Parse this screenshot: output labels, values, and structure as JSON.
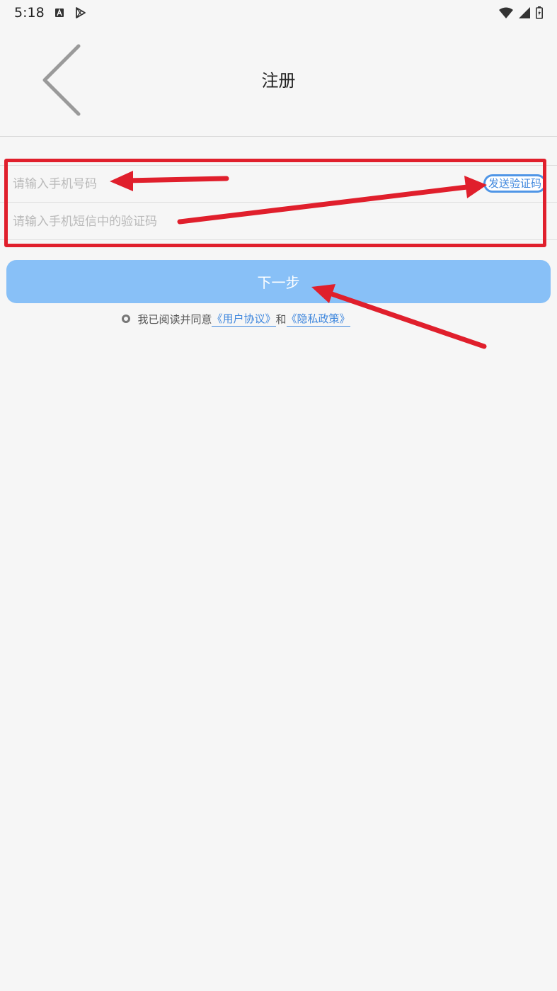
{
  "status_bar": {
    "time": "5:18",
    "icons": [
      "text-app-icon",
      "play-store-icon",
      "wifi-icon",
      "signal-icon",
      "battery-icon"
    ]
  },
  "header": {
    "back_icon": "chevron-left-icon",
    "title": "注册"
  },
  "form": {
    "phone_placeholder": "请输入手机号码",
    "phone_value": "",
    "code_placeholder": "请输入手机短信中的验证码",
    "code_value": "",
    "send_code_label": "发送验证码"
  },
  "actions": {
    "next_label": "下一步"
  },
  "agreement": {
    "prefix": "我已阅读并同意",
    "user_agreement": "《用户协议》",
    "and_text": "和",
    "privacy_policy": "《隐私政策》"
  },
  "colors": {
    "accent_blue": "#88c0f7",
    "link_blue": "#3f87dd",
    "annotation_red": "#e01f2c",
    "background": "#f6f6f6"
  }
}
